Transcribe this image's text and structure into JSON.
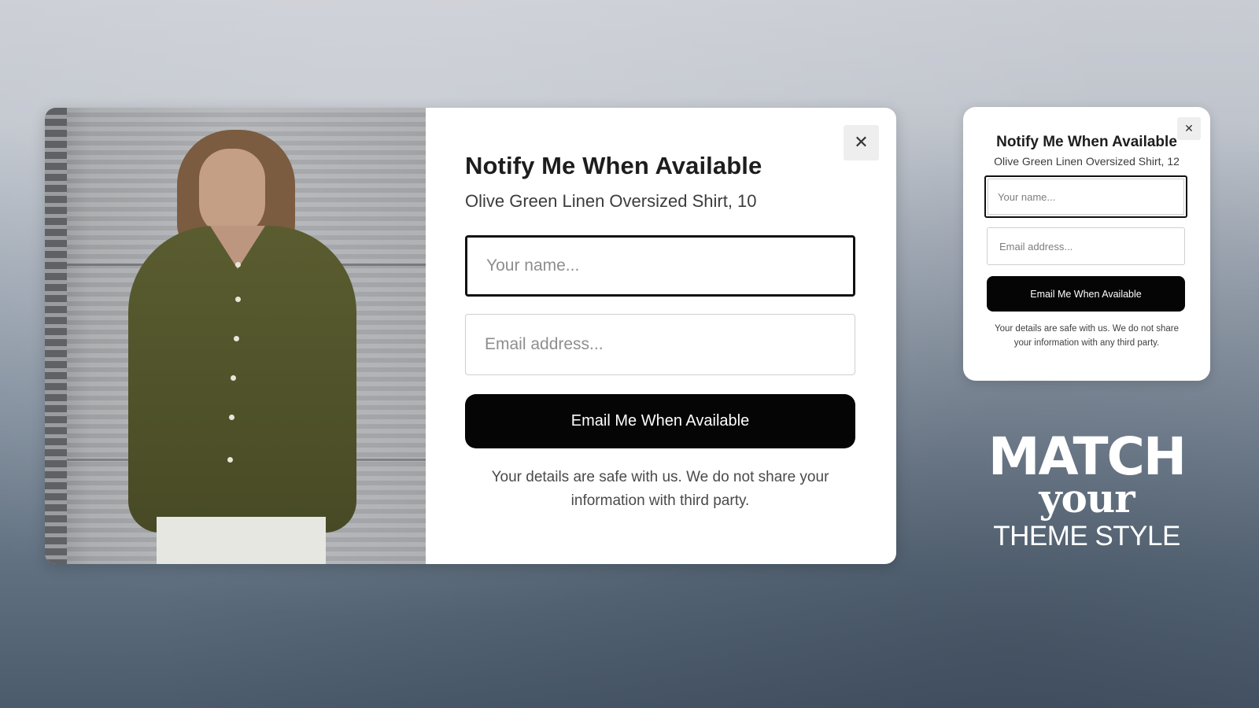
{
  "large_popup": {
    "image_alt": "Model wearing olive green linen oversized shirt",
    "close_symbol": "✕",
    "title": "Notify Me When Available",
    "subtitle": "Olive Green Linen Oversized Shirt, 10",
    "name_placeholder": "Your name...",
    "email_placeholder": "Email address...",
    "submit_label": "Email Me When Available",
    "note": "Your details are safe with us. We do not share your information with third party."
  },
  "small_popup": {
    "close_symbol": "✕",
    "title": "Notify Me When Available",
    "subtitle": "Olive Green Linen Oversized Shirt, 12",
    "name_placeholder": "Your name...",
    "email_placeholder": "Email address...",
    "submit_label": "Email Me When Available",
    "note": "Your details are safe with us. We do not share your information with any third party."
  },
  "tagline": {
    "line1": "MATCH",
    "line2": "your",
    "line3": "THEME STYLE"
  },
  "colors": {
    "button_bg": "#050505",
    "button_text": "#ffffff",
    "popup_bg": "#ffffff",
    "shirt": "#54572b"
  }
}
